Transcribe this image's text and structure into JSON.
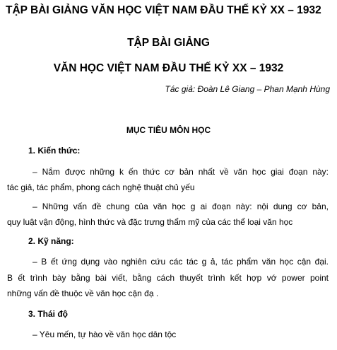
{
  "document": {
    "title": "TẬP BÀI GIẢNG VĂN HỌC VIỆT NAM ĐẦU THẾ KỶ XX – 1932",
    "heading_line1": "TẬP BÀI GIẢNG",
    "heading_line2": "VĂN HỌC VIỆT NAM ĐẦU THẾ KỶ XX – 1932",
    "authors": "Tác giả: Đoàn Lê Giang – Phan Mạnh Hùng",
    "section_title": "MỤC TIÊU MÔN HỌC",
    "knowledge": {
      "heading": "1. Kiến thức:",
      "p1_line1": "– Nắm được những k ến thức cơ bản nhất về văn học giai đoạn này:",
      "p1_line2": "tác giả, tác phẩm, phong cách nghệ thuật chủ yếu",
      "p2_line1": "– Những vấn đề chung của văn học g ai đoạn này: nội dung cơ bản,",
      "p2_line2": "quy luật vận động, hình thức và đặc trưng thẩm mỹ của các thể loại văn học"
    },
    "skills": {
      "heading": "2. Kỹ năng:",
      "p1_line1": "– B ết ứng dụng vào nghiên cứu các tác g ả, tác phẩm văn học cận đại.",
      "p1_line2": "B ết trình bày bằng bài viết, bằng cách thuyết trình kết hợp vớ  power point",
      "p1_line3": "những vấn đề thuộc về văn học cận đạ ."
    },
    "attitude": {
      "heading": "3. Thái độ",
      "p1_line1": "– Yêu mến, tự hào về văn học dân tộc"
    }
  }
}
